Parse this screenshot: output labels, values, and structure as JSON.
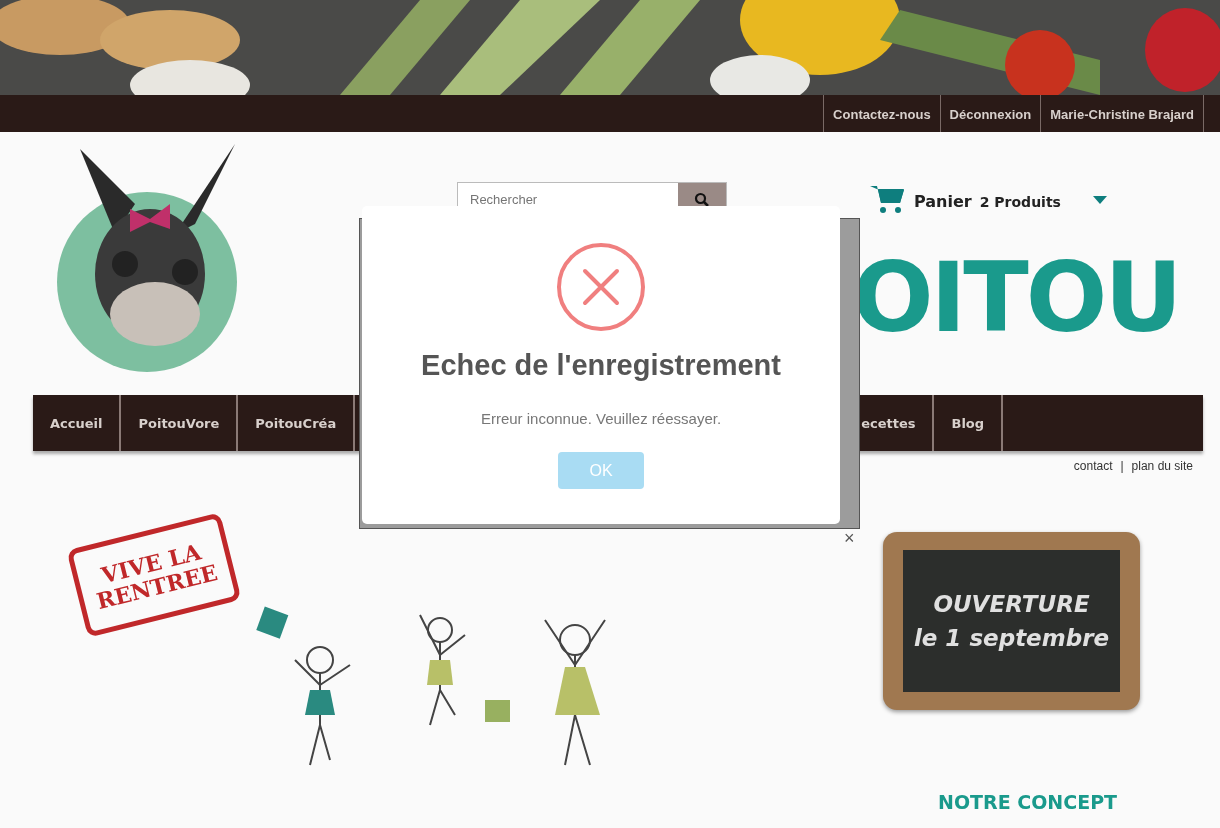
{
  "top_bar": {
    "links": [
      "Contactez-nous",
      "Déconnexion",
      "Marie-Christine Brajard"
    ]
  },
  "search": {
    "placeholder": "Rechercher"
  },
  "cart": {
    "label": "Panier",
    "count": "2 Produits"
  },
  "logo_text": "OITOU",
  "nav": {
    "left_items": [
      "Accueil",
      "PoitouVore",
      "PoitouCréa"
    ],
    "right_items": [
      "ecettes",
      "Blog"
    ]
  },
  "utility_links": {
    "items": [
      "contact",
      "plan du site"
    ],
    "separator": "|"
  },
  "modal": {
    "title": "Echec de l'enregistrement",
    "message": "Erreur inconnue. Veuillez réessayer.",
    "button": "OK",
    "close": "×"
  },
  "promo": {
    "stamp": [
      "VIVE LA",
      "RENTREE"
    ],
    "board": [
      "OUVERTURE",
      "le 1 septembre"
    ],
    "concept_title": "NOTRE CONCEPT"
  }
}
